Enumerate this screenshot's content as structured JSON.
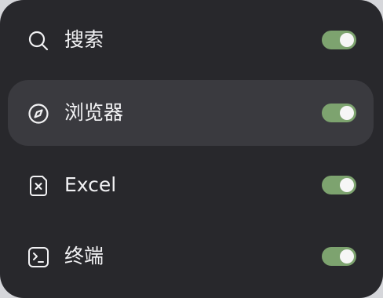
{
  "menu": {
    "accent_color": "#7da36f",
    "items": [
      {
        "label": "搜索",
        "icon": "search-icon",
        "enabled": true,
        "highlighted": false
      },
      {
        "label": "浏览器",
        "icon": "compass-icon",
        "enabled": true,
        "highlighted": true
      },
      {
        "label": "Excel",
        "icon": "excel-file-icon",
        "enabled": true,
        "highlighted": false
      },
      {
        "label": "终端",
        "icon": "terminal-icon",
        "enabled": true,
        "highlighted": false
      }
    ]
  }
}
